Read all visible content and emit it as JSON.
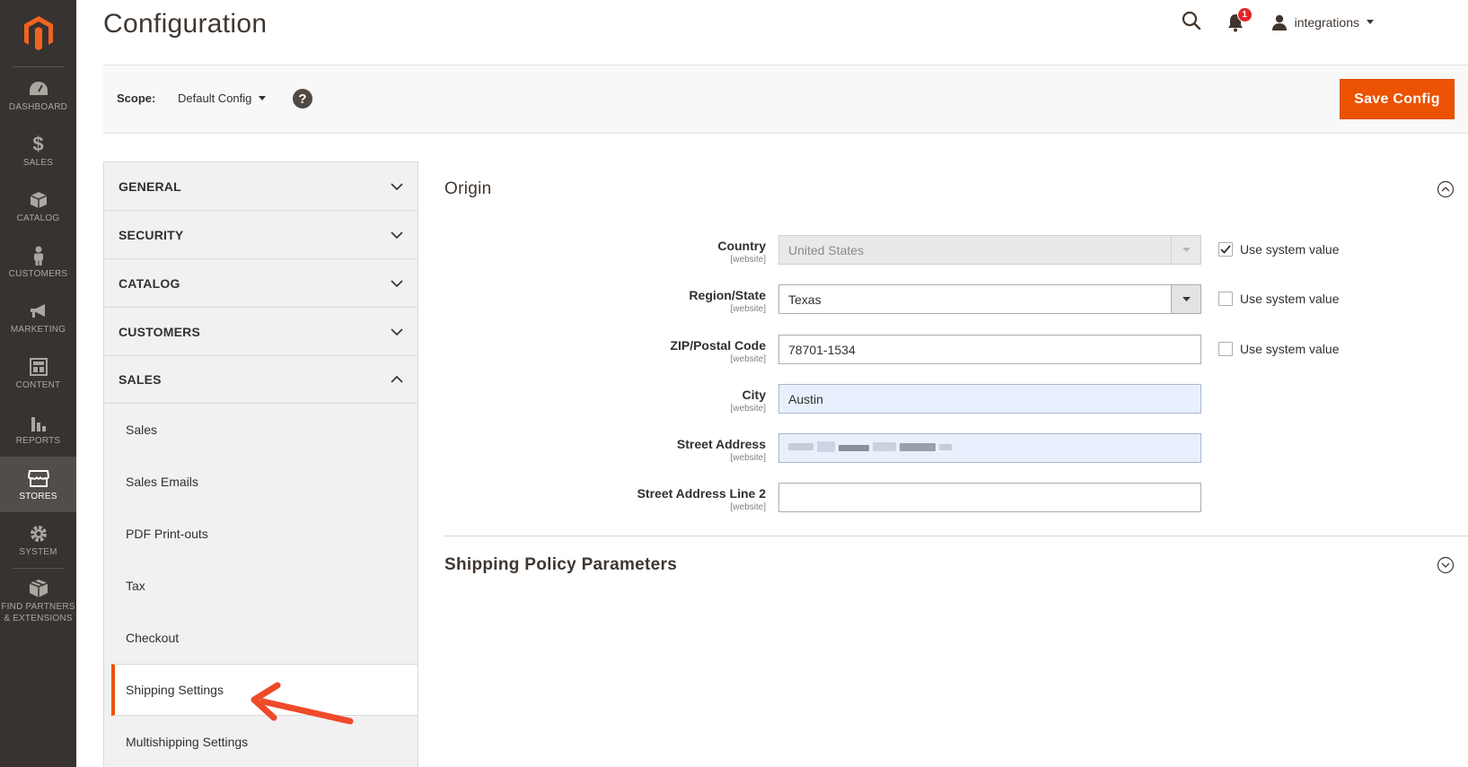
{
  "nav": {
    "items": [
      {
        "label": "DASHBOARD",
        "icon": "dashboard-icon"
      },
      {
        "label": "SALES",
        "icon": "dollar-icon"
      },
      {
        "label": "CATALOG",
        "icon": "cube-icon"
      },
      {
        "label": "CUSTOMERS",
        "icon": "person-icon"
      },
      {
        "label": "MARKETING",
        "icon": "megaphone-icon"
      },
      {
        "label": "CONTENT",
        "icon": "layout-icon"
      },
      {
        "label": "REPORTS",
        "icon": "bar-chart-icon"
      },
      {
        "label": "STORES",
        "icon": "storefront-icon"
      },
      {
        "label": "SYSTEM",
        "icon": "gear-icon"
      },
      {
        "label": "FIND PARTNERS & EXTENSIONS",
        "icon": "boxes-icon"
      }
    ],
    "active": "STORES"
  },
  "header": {
    "title": "Configuration",
    "notification_count": "1",
    "user": "integrations"
  },
  "scope": {
    "label": "Scope:",
    "value": "Default Config",
    "save_label": "Save Config"
  },
  "tabs": {
    "sections": [
      "GENERAL",
      "SECURITY",
      "CATALOG",
      "CUSTOMERS",
      "SALES"
    ],
    "open": "SALES",
    "sales_items": [
      "Sales",
      "Sales Emails",
      "PDF Print-outs",
      "Tax",
      "Checkout",
      "Shipping Settings",
      "Multishipping Settings"
    ],
    "current": "Shipping Settings"
  },
  "origin": {
    "title": "Origin",
    "scope_tag": "[website]",
    "use_system": "Use system value",
    "fields": {
      "country": {
        "label": "Country",
        "value": "United States",
        "use_system": true
      },
      "region": {
        "label": "Region/State",
        "value": "Texas",
        "use_system": false
      },
      "zip": {
        "label": "ZIP/Postal Code",
        "value": "78701-1534",
        "use_system": false
      },
      "city": {
        "label": "City",
        "value": "Austin"
      },
      "street": {
        "label": "Street Address",
        "value": ""
      },
      "street2": {
        "label": "Street Address Line 2",
        "value": ""
      }
    }
  },
  "shipping_policy": {
    "title": "Shipping Policy Parameters"
  },
  "colors": {
    "accent": "#eb5202",
    "nav_bg": "#373330",
    "annotation_arrow": "#ef4a2a"
  }
}
